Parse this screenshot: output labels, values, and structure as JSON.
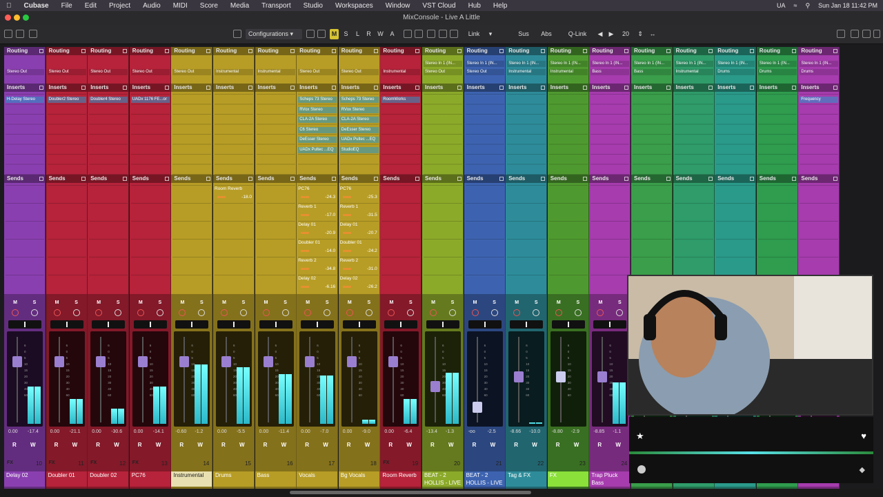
{
  "menubar": {
    "apple": "",
    "app": "Cubase",
    "items": [
      "File",
      "Edit",
      "Project",
      "Audio",
      "MIDI",
      "Score",
      "Media",
      "Transport",
      "Studio",
      "Workspaces",
      "Window",
      "VST Cloud",
      "Hub",
      "Help"
    ],
    "right_ua": "UA",
    "clock": "Sun Jan 18  11:42 PM"
  },
  "window": {
    "title": "MixConsole - Live A Little"
  },
  "toolbar": {
    "configurations": "Configurations",
    "m": "M",
    "s": "S",
    "l": "L",
    "r": "R",
    "w": "W",
    "a": "A",
    "link": "Link",
    "sus": "Sus",
    "abs": "Abs",
    "qlink": "Q-Link",
    "count": "20"
  },
  "labels": {
    "routing": "Routing",
    "inserts": "Inserts",
    "sends": "Sends",
    "m": "M",
    "s": "S",
    "r": "R",
    "w": "W"
  },
  "colors": {
    "purple": "#8a3fb0",
    "red": "#b6233a",
    "yellow": "#b79d26",
    "lime": "#8caa2a",
    "blue": "#3d63b0",
    "teal": "#2e8c9a",
    "cyan": "#1f8fa6",
    "green": "#3e9c3a",
    "magenta": "#a63cae",
    "accent": "#3ed7e0"
  },
  "channels": [
    {
      "name": "Delay 02",
      "num": "10",
      "color": "#8a3fb0",
      "out1": "Stereo Out",
      "out2": "",
      "inserts": [
        "H-Delay Stereo"
      ],
      "sends": [],
      "vol": "0.00",
      "peak": "-17.4",
      "fader": 0.25,
      "meter": 0.45,
      "namebg": "#8a3fb0",
      "numlabel": "FX"
    },
    {
      "name": "Doubler 01",
      "num": "11",
      "color": "#b6233a",
      "out1": "Stereo Out",
      "out2": "",
      "inserts": [
        "Doubler2 Stereo"
      ],
      "sends": [],
      "vol": "0.00",
      "peak": "-21.1",
      "fader": 0.25,
      "meter": 0.3,
      "namebg": "#b6233a",
      "numlabel": "FX"
    },
    {
      "name": "Doubler 02",
      "num": "12",
      "color": "#b6233a",
      "out1": "Stereo Out",
      "out2": "",
      "inserts": [
        "Doubler4 Stereo"
      ],
      "sends": [],
      "vol": "0.00",
      "peak": "-30.6",
      "fader": 0.25,
      "meter": 0.18,
      "namebg": "#b6233a",
      "numlabel": "FX"
    },
    {
      "name": "PC76",
      "num": "13",
      "color": "#b6233a",
      "out1": "Stereo Out",
      "out2": "",
      "inserts": [
        "UADx 1176 FE...or"
      ],
      "sends": [],
      "vol": "0.00",
      "peak": "-14.1",
      "fader": 0.25,
      "meter": 0.45,
      "namebg": "#b6233a",
      "numlabel": "FX"
    },
    {
      "name": "Instrumental",
      "num": "14",
      "color": "#b79d26",
      "out1": "Stereo Out",
      "out2": "",
      "inserts": [],
      "sends": [],
      "vol": "-0.60",
      "peak": "-1.2",
      "fader": 0.25,
      "meter": 0.72,
      "namebg": "#e8e0b0",
      "numlabel": ""
    },
    {
      "name": "Drums",
      "num": "15",
      "color": "#b79d26",
      "out1": "Instrumental",
      "out2": "",
      "inserts": [],
      "sends": [
        {
          "n": "Room Reverb",
          "v": "-18.0"
        }
      ],
      "vol": "0.00",
      "peak": "-5.5",
      "fader": 0.25,
      "meter": 0.68,
      "namebg": "#b79d26",
      "numlabel": ""
    },
    {
      "name": "Bass",
      "num": "16",
      "color": "#b79d26",
      "out1": "Instrumental",
      "out2": "",
      "inserts": [],
      "sends": [],
      "vol": "0.00",
      "peak": "-11.4",
      "fader": 0.25,
      "meter": 0.6,
      "namebg": "#b79d26",
      "numlabel": ""
    },
    {
      "name": "Vocals",
      "num": "17",
      "color": "#b79d26",
      "out1": "Stereo Out",
      "out2": "",
      "inserts": [
        "Scheps 73 Stereo",
        "RVox Stereo",
        "CLA-2A Stereo",
        "C6 Stereo",
        "DeEsser Stereo",
        "UADx Pultec ...EQ"
      ],
      "sends": [
        {
          "n": "PC76",
          "v": "-24.3"
        },
        {
          "n": "Reverb 1",
          "v": "-17.0"
        },
        {
          "n": "Delay 01",
          "v": "-20.9"
        },
        {
          "n": "Doubler 01",
          "v": "-14.0"
        },
        {
          "n": "Reverb 2",
          "v": "-34.8"
        },
        {
          "n": "Delay 02",
          "v": "-6.16"
        }
      ],
      "vol": "0.00",
      "peak": "-7.0",
      "fader": 0.25,
      "meter": 0.58,
      "namebg": "#b79d26",
      "numlabel": ""
    },
    {
      "name": "Bg Vocals",
      "num": "18",
      "color": "#b79d26",
      "out1": "Stereo Out",
      "out2": "",
      "inserts": [
        "Scheps 73 Stereo",
        "RVox Stereo",
        "CLA-2A Stereo",
        "DeEsser Stereo",
        "UADx Pultec ...EQ",
        "StudioEQ"
      ],
      "sends": [
        {
          "n": "PC76",
          "v": "-25.3"
        },
        {
          "n": "Reverb 1",
          "v": "-31.5"
        },
        {
          "n": "Delay 01",
          "v": "-20.7"
        },
        {
          "n": "Doubler 01",
          "v": "-24.2"
        },
        {
          "n": "Reverb 2",
          "v": "-31.0"
        },
        {
          "n": "Delay 02",
          "v": "-26.2"
        }
      ],
      "vol": "0.00",
      "peak": "-9.0",
      "fader": 0.25,
      "meter": 0.05,
      "namebg": "#b79d26",
      "numlabel": ""
    },
    {
      "name": "Room Reverb",
      "num": "19",
      "color": "#b6233a",
      "out1": "Instrumental",
      "out2": "",
      "inserts": [
        "RoomWorks"
      ],
      "sends": [],
      "vol": "0.00",
      "peak": "-6.4",
      "fader": 0.25,
      "meter": 0.3,
      "namebg": "#b6233a",
      "numlabel": "FX"
    },
    {
      "name": "BEAT - 2 HOLLIS - LIVE A LITTLE",
      "num": "20",
      "color": "#8caa2a",
      "out1": "Stereo In 1 (IN...",
      "out2": "Stereo Out",
      "inserts": [],
      "sends": [],
      "vol": "-13.4",
      "peak": "-1.3",
      "fader": 0.58,
      "meter": 0.62,
      "namebg": "#8caa2a",
      "numlabel": ""
    },
    {
      "name": "BEAT - 2 HOLLIS - LIVE A LITTLE",
      "num": "21",
      "color": "#3d63b0",
      "out1": "Stereo In 1 (IN...",
      "out2": "Stereo Out",
      "inserts": [],
      "sends": [],
      "vol": "-oo",
      "peak": "-2.5",
      "fader": 0.85,
      "meter": 0.0,
      "namebg": "#3d63b0",
      "numlabel": ""
    },
    {
      "name": "Tag & FX",
      "num": "22",
      "color": "#2e8c9a",
      "out1": "Stereo In 1 (IN...",
      "out2": "Instrumental",
      "inserts": [],
      "sends": [],
      "vol": "-8.66",
      "peak": "-10.0",
      "fader": 0.45,
      "meter": 0.02,
      "namebg": "#2e8c9a",
      "numlabel": ""
    },
    {
      "name": "FX",
      "num": "23",
      "color": "#4f9a30",
      "out1": "Stereo In 1 (IN...",
      "out2": "Instrumental",
      "inserts": [],
      "sends": [],
      "vol": "-8.80",
      "peak": "-2.9",
      "fader": 0.45,
      "meter": 0.0,
      "namebg": "#8be03a",
      "numlabel": ""
    },
    {
      "name": "Trap Pluck Bass",
      "num": "24",
      "color": "#a63cae",
      "out1": "Stereo In 1 (IN...",
      "out2": "Bass",
      "inserts": [],
      "sends": [],
      "vol": "-8.85",
      "peak": "-1.1",
      "fader": 0.45,
      "meter": 0.5,
      "namebg": "#a63cae",
      "numlabel": ""
    },
    {
      "name": "",
      "num": "",
      "color": "#3a9e4a",
      "out1": "Stereo In 1 (IN...",
      "out2": "Bass",
      "inserts": [],
      "sends": [],
      "vol": "",
      "peak": "",
      "fader": 0.3,
      "meter": 0,
      "namebg": "#3a9e4a",
      "numlabel": ""
    },
    {
      "name": "",
      "num": "",
      "color": "#2f9c6a",
      "out1": "Stereo In 1 (IN...",
      "out2": "Instrumental",
      "inserts": [],
      "sends": [],
      "vol": "",
      "peak": "",
      "fader": 0.3,
      "meter": 0,
      "namebg": "#2f9c6a",
      "numlabel": ""
    },
    {
      "name": "",
      "num": "",
      "color": "#2a9a8a",
      "out1": "Stereo In 1 (IN...",
      "out2": "Drums",
      "inserts": [],
      "sends": [],
      "vol": "",
      "peak": "",
      "fader": 0.3,
      "meter": 0,
      "namebg": "#2a9a8a",
      "numlabel": ""
    },
    {
      "name": "",
      "num": "",
      "color": "#2f9c4e",
      "out1": "Stereo In 1 (IN...",
      "out2": "Drums",
      "inserts": [],
      "sends": [],
      "vol": "",
      "peak": "",
      "fader": 0.3,
      "meter": 0,
      "namebg": "#2f9c4e",
      "numlabel": ""
    },
    {
      "name": "",
      "num": "",
      "color": "#a63cae",
      "out1": "Stereo In 1 (IN...",
      "out2": "Drums",
      "inserts": [
        "Frequency"
      ],
      "sends": [],
      "vol": "",
      "peak": "",
      "fader": 0.3,
      "meter": 0,
      "namebg": "#a63cae",
      "numlabel": ""
    }
  ]
}
